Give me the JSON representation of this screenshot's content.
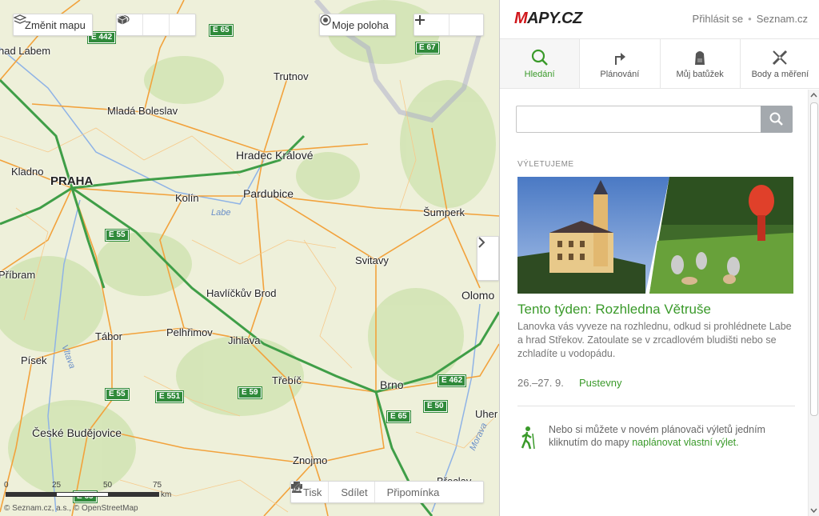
{
  "map_controls": {
    "change_map": "Změnit mapu",
    "my_location": "Moje poloha",
    "print": "Tisk",
    "share": "Sdílet",
    "reminder": "Připomínka"
  },
  "cities": [
    {
      "name": "nad Labem",
      "cls": ""
    },
    {
      "name": "Trutnov",
      "cls": ""
    },
    {
      "name": "Mladá Boleslav",
      "cls": ""
    },
    {
      "name": "Hradec Králové",
      "cls": "big"
    },
    {
      "name": "Kladno",
      "cls": ""
    },
    {
      "name": "PRAHA",
      "cls": "capital"
    },
    {
      "name": "Kolín",
      "cls": ""
    },
    {
      "name": "Pardubice",
      "cls": "big"
    },
    {
      "name": "Šumperk",
      "cls": ""
    },
    {
      "name": "Svitavy",
      "cls": ""
    },
    {
      "name": "Příbram",
      "cls": ""
    },
    {
      "name": "Havlíčkův Brod",
      "cls": ""
    },
    {
      "name": "Olomo",
      "cls": "big"
    },
    {
      "name": "Tábor",
      "cls": ""
    },
    {
      "name": "Pelhřimov",
      "cls": ""
    },
    {
      "name": "Jihlava",
      "cls": ""
    },
    {
      "name": "Písek",
      "cls": ""
    },
    {
      "name": "Třebíč",
      "cls": ""
    },
    {
      "name": "Brno",
      "cls": "big"
    },
    {
      "name": "Uher",
      "cls": ""
    },
    {
      "name": "České Budějovice",
      "cls": "big"
    },
    {
      "name": "Znojmo",
      "cls": ""
    },
    {
      "name": "Břeclav",
      "cls": ""
    }
  ],
  "rivers": [
    "Labe",
    "Vltava",
    "Morava"
  ],
  "road_shields": [
    "E 442",
    "E 65",
    "E 67",
    "E 55",
    "E 55",
    "E 551",
    "E 59",
    "E 462",
    "E 50",
    "E 65",
    "E 65"
  ],
  "scale": {
    "ticks": [
      "0",
      "25",
      "50",
      "75"
    ],
    "unit": "km"
  },
  "copyright": "© Seznam.cz, a.s., © OpenStreetMap",
  "panel": {
    "logo_m": "M",
    "logo_rest": "APY.CZ",
    "login": "Přihlásit se",
    "seznam": "Seznam.cz",
    "tabs": [
      "Hledání",
      "Plánování",
      "Můj batůžek",
      "Body a měření"
    ],
    "search_placeholder": "",
    "section_label": "VÝLETUJEME",
    "article_title": "Tento týden: Rozhledna Větruše",
    "article_text": "Lanovka vás vyveze na rozhlednu, odkud si prohlédnete Labe a hrad Střekov. Zatoulate se v zrcadlovém bludišti nebo se zchladíte u vodopádu.",
    "article_date": "26.–27. 9.",
    "article_location": "Pustevny",
    "plan_text": "Nebo si můžete v novém plánovači výletů jedním kliknutím do mapy",
    "plan_link": "naplánovat vlastní výlet."
  }
}
